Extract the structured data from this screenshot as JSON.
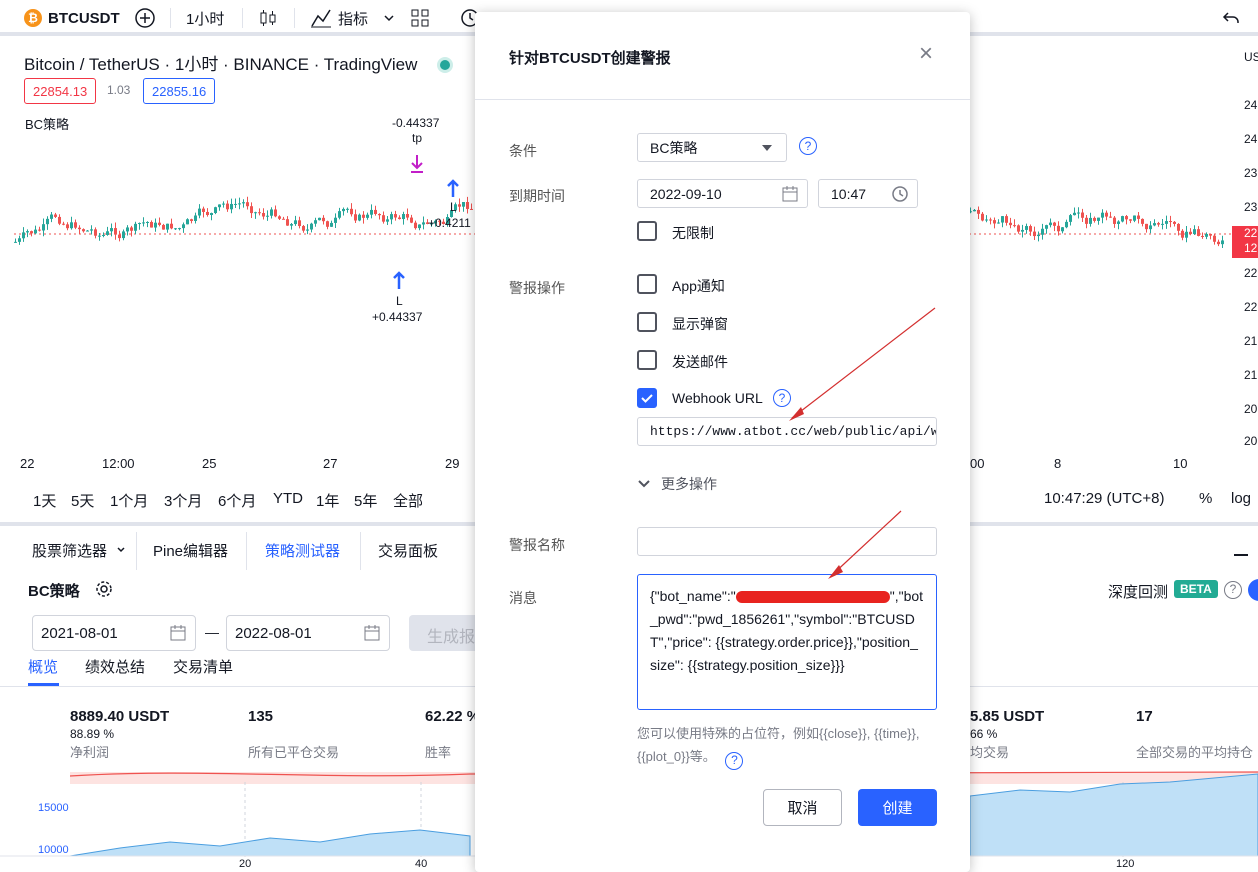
{
  "toolbar": {
    "symbol": "BTCUSDT",
    "coin_glyph": "₿",
    "interval": "1小时",
    "indicators_label": "指标"
  },
  "chart": {
    "title": "Bitcoin / TetherUS · 1小时 · BINANCE · TradingView",
    "price_bid": "22854.13",
    "spread": "1.03",
    "price_ask": "22855.16",
    "strategy_label": "BC策略",
    "markers": {
      "exit_value": "-0.44337",
      "exit_tag": "tp",
      "entry_tag_1": "L",
      "entry_value": "+0.44337",
      "entry_tag_2": "L",
      "entry_value_2": "+0.4211"
    },
    "x_labels_left": [
      "22",
      "12:00",
      "25",
      "27",
      "29"
    ],
    "x_labels_right": [
      "00",
      "8",
      "10"
    ],
    "y_labels": [
      "US",
      "24",
      "24",
      "23",
      "23",
      "22",
      "22",
      "21",
      "21",
      "20",
      "20"
    ],
    "last_price_tag_1": "22",
    "last_price_tag_2": "12"
  },
  "range_bar": {
    "ranges": [
      "1天",
      "5天",
      "1个月",
      "3个月",
      "6个月",
      "YTD",
      "1年",
      "5年",
      "全部"
    ],
    "clock": "10:47:29 (UTC+8)",
    "percent": "%",
    "log": "log"
  },
  "panel": {
    "tabs": [
      "股票筛选器",
      "Pine编辑器",
      "策略测试器",
      "交易面板"
    ],
    "strategy_name": "BC策略",
    "date_from": "2021-08-01",
    "date_to": "2022-08-01",
    "date_dash": "—",
    "generate_label": "生成报",
    "subtabs": [
      "概览",
      "绩效总结",
      "交易清单"
    ],
    "deep_backtest": "深度回测",
    "beta": "BETA",
    "stats": [
      {
        "value": "8889.40 USDT",
        "sub": "88.89 %",
        "label": "净利润"
      },
      {
        "value": "135",
        "label": "所有已平仓交易"
      },
      {
        "value": "62.22 %",
        "label": "胜率"
      },
      {
        "value": "5.85 USDT",
        "sub": "66 %",
        "label": "均交易"
      },
      {
        "value": "17",
        "label": "全部交易的平均持仓"
      }
    ],
    "equity_y": [
      "15000",
      "10000"
    ],
    "equity_x": [
      "20",
      "40",
      "120"
    ]
  },
  "dialog": {
    "title": "针对BTCUSDT创建警报",
    "close_glyph": "×",
    "condition_label": "条件",
    "condition_value": "BC策略",
    "expiry_label": "到期时间",
    "expiry_date": "2022-09-10",
    "expiry_time": "10:47",
    "unlimited_label": "无限制",
    "actions_label": "警报操作",
    "action_app": "App通知",
    "action_popup": "显示弹窗",
    "action_email": "发送邮件",
    "action_webhook": "Webhook URL",
    "webhook_url": "https://www.atbot.cc/web/public/api/we",
    "more_actions": "更多操作",
    "name_label": "警报名称",
    "name_value": "",
    "message_label": "消息",
    "message_part1": "{\"bot_name\":\"",
    "message_part2": "\",\"bot_pwd\":\"pwd_1856261\",\"symbol\":\"BTCUSDT\",\"price\": {{strategy.order.price}},\"position_size\": {{strategy.position_size}}}",
    "hint": "您可以使用特殊的占位符，例如{{close}}, {{time}}, {{plot_0}}等。",
    "help_glyph": "?",
    "cancel_label": "取消",
    "create_label": "创建"
  },
  "colors": {
    "accent": "#2962ff",
    "bid_red": "#f23645",
    "up_green": "#26a69a",
    "down_red": "#ef5350",
    "annotation_red": "#d32f2f"
  }
}
